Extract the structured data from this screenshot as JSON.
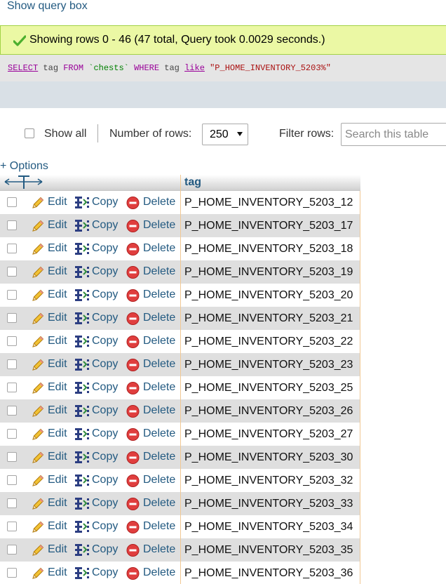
{
  "show_query_link": "Show query box",
  "success": {
    "message": "Showing rows 0 - 46 (47 total, Query took 0.0029 seconds.)",
    "icon": "check-icon",
    "color": "#ebf8a4"
  },
  "sql": {
    "select": "SELECT",
    "col": " tag ",
    "from": "FROM",
    "table": " `chests` ",
    "where": "WHERE",
    "col2": " tag ",
    "like": "like",
    "pattern": " \"P_HOME_INVENTORY_5203%\""
  },
  "navigation": {
    "show_all_label": "Show all",
    "rows_label": "Number of rows:",
    "rows_value": "250",
    "filter_label": "Filter rows:",
    "filter_placeholder": "Search this table"
  },
  "options_link": "+ Options",
  "table": {
    "column_header": "tag",
    "actions": {
      "edit": "Edit",
      "copy": "Copy",
      "delete": "Delete"
    },
    "rows": [
      "P_HOME_INVENTORY_5203_12",
      "P_HOME_INVENTORY_5203_17",
      "P_HOME_INVENTORY_5203_18",
      "P_HOME_INVENTORY_5203_19",
      "P_HOME_INVENTORY_5203_20",
      "P_HOME_INVENTORY_5203_21",
      "P_HOME_INVENTORY_5203_22",
      "P_HOME_INVENTORY_5203_23",
      "P_HOME_INVENTORY_5203_25",
      "P_HOME_INVENTORY_5203_26",
      "P_HOME_INVENTORY_5203_27",
      "P_HOME_INVENTORY_5203_30",
      "P_HOME_INVENTORY_5203_32",
      "P_HOME_INVENTORY_5203_33",
      "P_HOME_INVENTORY_5203_34",
      "P_HOME_INVENTORY_5203_35",
      "P_HOME_INVENTORY_5203_36"
    ]
  },
  "colors": {
    "link": "#235a81",
    "row_alt": "#dfdfdf",
    "delete_icon": "#e03e3e"
  }
}
